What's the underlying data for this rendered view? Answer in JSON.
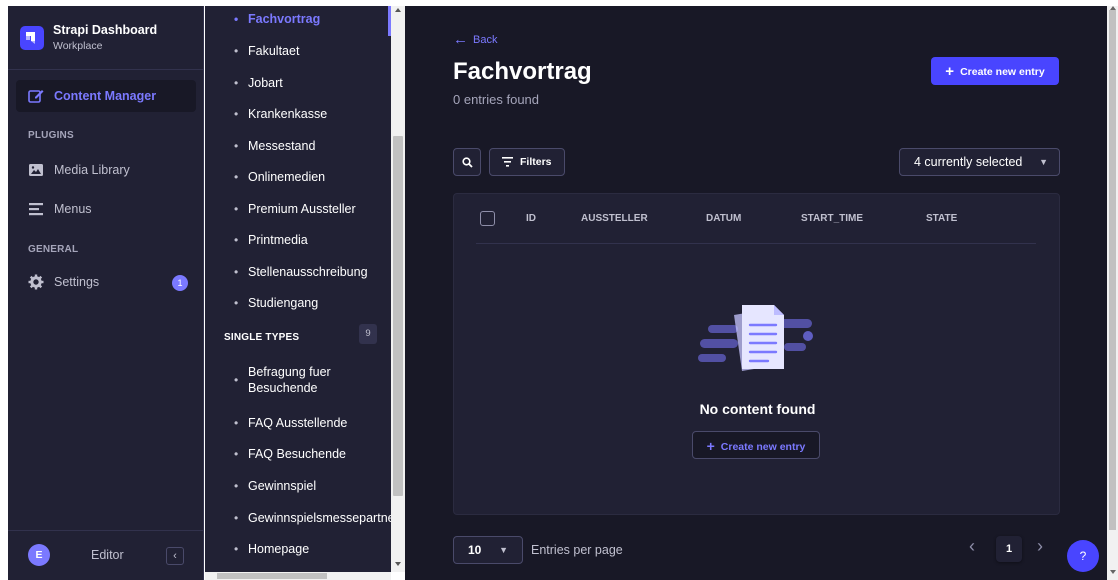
{
  "brand": {
    "title": "Strapi Dashboard",
    "subtitle": "Workplace"
  },
  "nav": {
    "content_manager": "Content Manager",
    "plugins_section": "PLUGINS",
    "media_library": "Media Library",
    "menus": "Menus",
    "general_section": "GENERAL",
    "settings": "Settings",
    "settings_badge": "1"
  },
  "footer": {
    "avatar_initial": "E",
    "user_name": "Editor",
    "collapse_glyph": "‹"
  },
  "subnav": {
    "collection_items": [
      {
        "label": "Fachvortrag",
        "active": true
      },
      {
        "label": "Fakultaet"
      },
      {
        "label": "Jobart"
      },
      {
        "label": "Krankenkasse"
      },
      {
        "label": "Messestand"
      },
      {
        "label": "Onlinemedien"
      },
      {
        "label": "Premium Aussteller"
      },
      {
        "label": "Printmedia"
      },
      {
        "label": "Stellenausschreibung"
      },
      {
        "label": "Studiengang"
      }
    ],
    "single_types_label": "SINGLE TYPES",
    "single_types_count": "9",
    "single_items": [
      {
        "label": "Befragung fuer Besuchende"
      },
      {
        "label": "FAQ Ausstellende"
      },
      {
        "label": "FAQ Besuchende"
      },
      {
        "label": "Gewinnspiel"
      },
      {
        "label": "Gewinnspielsmessepartner"
      },
      {
        "label": "Homepage"
      }
    ]
  },
  "main": {
    "back": "Back",
    "title": "Fachvortrag",
    "subtitle": "0 entries found",
    "create_button": "Create new entry",
    "filters_button": "Filters",
    "columns_select": "4 currently selected",
    "table": {
      "headers": [
        "ID",
        "AUSSTELLER",
        "DATUM",
        "START_TIME",
        "STATE"
      ],
      "empty_text": "No content found",
      "empty_create": "Create new entry"
    },
    "pagination": {
      "per_page": "10",
      "per_page_label": "Entries per page",
      "current_page": "1"
    },
    "help": "?"
  },
  "colors": {
    "primary": "#4945ff",
    "accent": "#7b79ff",
    "background": "#181826",
    "surface": "#212134"
  }
}
